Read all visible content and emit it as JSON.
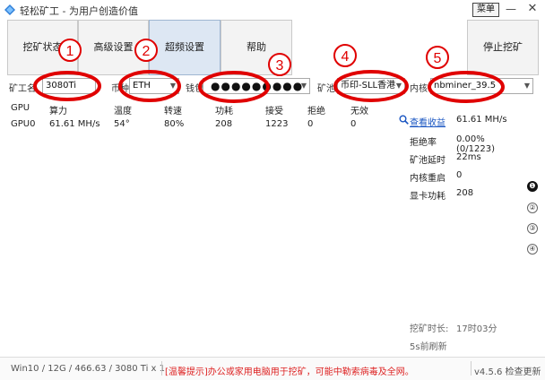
{
  "window": {
    "title": "轻松矿工 - 为用户创造价值",
    "menu_label": "菜单",
    "minimize_symbol": "—",
    "close_symbol": "✕"
  },
  "toolbar": {
    "tabs": [
      {
        "label": "挖矿状态"
      },
      {
        "label": "高级设置"
      },
      {
        "label": "超频设置"
      },
      {
        "label": "帮助"
      }
    ],
    "stop_label": "停止挖矿"
  },
  "form": {
    "miner_name_label": "矿工名",
    "miner_name_value": "3080Ti",
    "coin_label": "币种",
    "coin_value": "ETH",
    "wallet_label": "钱包",
    "wallet_masked": "●●●●●●●●●",
    "pool_label": "矿池",
    "pool_value": "币印-SLL香港",
    "kernel_label": "内核",
    "kernel_value": "nbminer_39.5"
  },
  "table": {
    "headers": [
      "GPU",
      "算力",
      "温度",
      "转速",
      "功耗",
      "接受",
      "拒绝",
      "无效"
    ],
    "rows": [
      [
        "GPU0",
        "61.61 MH/s",
        "54°",
        "80%",
        "208",
        "1223",
        "0",
        "0"
      ]
    ]
  },
  "stats": {
    "view_earnings": "查看收益",
    "hashrate": "61.61 MH/s",
    "reject_rate_label": "拒绝率",
    "reject_rate_value": "0.00%(0/1223)",
    "pool_latency_label": "矿池延时",
    "pool_latency_value": "22ms",
    "kernel_restart_label": "内核重启",
    "kernel_restart_value": "0",
    "gpu_power_label": "显卡功耗",
    "gpu_power_value": "208"
  },
  "page_indicators": [
    "❶",
    "②",
    "③",
    "④"
  ],
  "mining_time": {
    "label": "挖矿时长:",
    "value": "17时03分",
    "refresh": "5s前刷新"
  },
  "statusbar": {
    "system": "Win10 / 12G / 466.63 / 3080 Ti x 1",
    "warning": "[温馨提示]办公或家用电脑用于挖矿，可能中勒索病毒及全网。",
    "version": "v4.5.6 检查更新"
  },
  "annotations": [
    "1",
    "2",
    "3",
    "4",
    "5"
  ],
  "colors": {
    "annotation_red": "#e00000",
    "warning_red": "#dd2222",
    "link_blue": "#1a56c2",
    "active_tab": "#dde7f3"
  }
}
